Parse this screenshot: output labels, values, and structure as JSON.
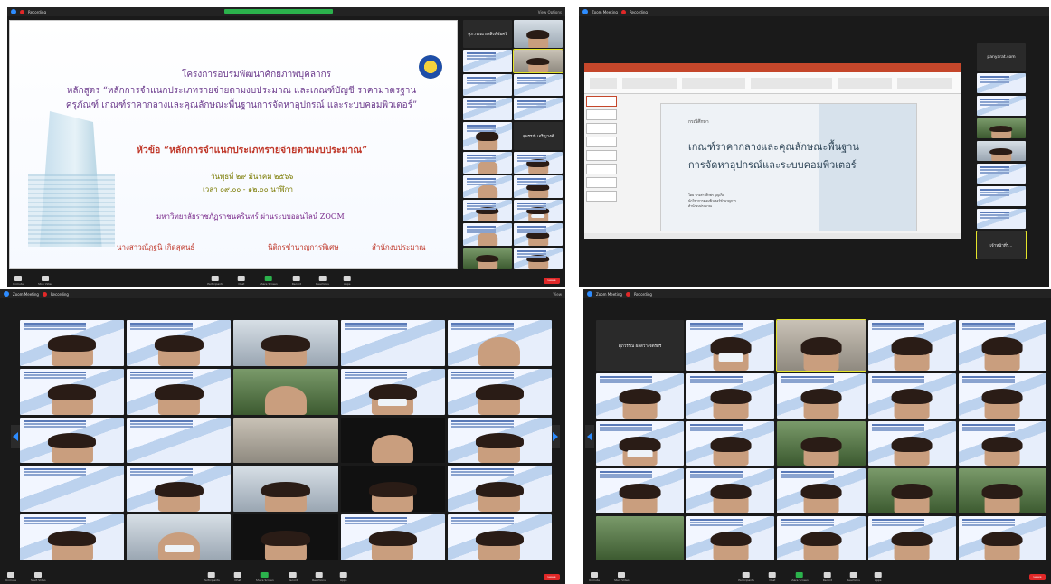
{
  "panel1": {
    "recording": "Recording",
    "view_options": "View Options",
    "slide": {
      "line1": "โครงการอบรมพัฒนาศักยภาพบุคลากร",
      "line2": "หลักสูตร “หลักการจำแนกประเภทรายจ่ายตามงบประมาณ และเกณฑ์บัญชี ราคามาตรฐานครุภัณฑ์ เกณฑ์ราคากลางและคุณลักษณะพื้นฐานการจัดหาอุปกรณ์ และระบบคอมพิวเตอร์”",
      "topic": "หัวข้อ “หลักการจำแนกประเภทรายจ่ายตามงบประมาณ”",
      "date": "วันพุธที่ ๒๙ มีนาคม ๒๕๖๖",
      "time": "เวลา ๐๙.๐๐ - ๑๒.๐๐ นาฬิกา",
      "venue": "มหาวิทยาลัยราชภัฏราชนครินทร์ ผ่านระบบออนไลน์ ZOOM",
      "speaker": "นางสาวณัฏฐนิ เกิดสุคนธ์",
      "position": "นิติกรชำนาญการพิเศษ",
      "office": "สำนักงบประมาณ"
    },
    "side_names": [
      "ศุภวรรณ ผลสิงห์ชัยศรี",
      "สุพรรณี เจริญวงศ์"
    ],
    "toolbar": [
      "Unmute",
      "Stop Video",
      "Participants",
      "Chat",
      "Share Screen",
      "Record",
      "Reactions",
      "Apps"
    ],
    "end": "Leave"
  },
  "panel2": {
    "title": "Zoom Meeting",
    "recording": "Recording",
    "ppt": {
      "label": "กรณีศึกษา",
      "heading1": "เกณฑ์ราคากลางและคุณลักษณะพื้นฐาน",
      "heading2": "การจัดหาอุปกรณ์และระบบคอมพิวเตอร์",
      "footer1": "โดย นางสาวศิวพร บุญเกิด",
      "footer2": "นักวิชาการคอมพิวเตอร์ชำนาญการ",
      "footer3": "สำนักงบประมาณ"
    },
    "side_name": "panyarat.som",
    "active_name": "เจ้าหน้าที่ร..."
  },
  "panel3": {
    "title": "Zoom Meeting",
    "recording": "Recording",
    "view": "View",
    "toolbar": [
      "Unmute",
      "Start Video",
      "Participants",
      "Chat",
      "Share Screen",
      "Record",
      "Reactions",
      "Apps"
    ],
    "end": "Leave"
  },
  "panel4": {
    "title": "Zoom Meeting",
    "recording": "Recording",
    "first_name": "ศุภวรรณ ผลสว่างจิตรศรี",
    "toolbar": [
      "Unmute",
      "Start Video",
      "Participants",
      "Chat",
      "Share Screen",
      "Record",
      "Reactions",
      "Apps"
    ],
    "end": "Leave"
  }
}
